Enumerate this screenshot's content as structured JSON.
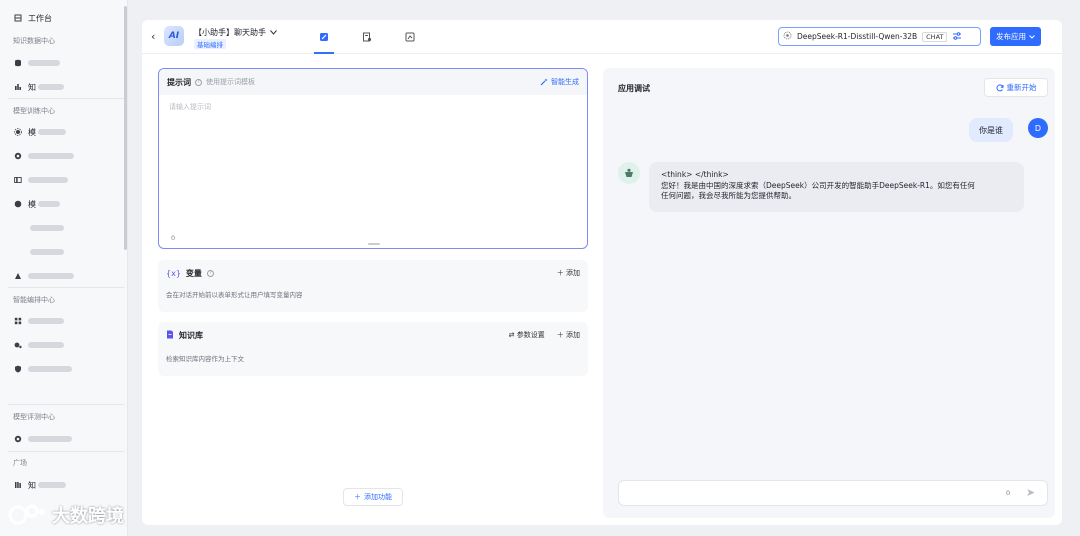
{
  "sidebar": {
    "top_item": "工作台",
    "section_knowledge": "知识数据中心",
    "knowledge_item_2_prefix": "知",
    "section_model_train": "模型训练中心",
    "model_item_1_prefix": "模",
    "model_item_4_prefix": "模",
    "section_orchestration": "智能编排中心",
    "section_model_eval": "模型评测中心",
    "section_plaza": "广场",
    "plaza_item_1_prefix": "知"
  },
  "header": {
    "app_name": "【小助手】聊天助手",
    "app_tag": "基础编排",
    "logo_text": "AI",
    "model_name": "DeepSeek-R1-Disstill-Qwen-32B",
    "model_badge": "CHAT",
    "publish_label": "发布应用"
  },
  "prompt": {
    "title": "提示词",
    "template_hint": "使用提示词模板",
    "ai_generate_label": "智能生成",
    "placeholder": "请输入提示词",
    "char_count": "0"
  },
  "variables": {
    "title": "变量",
    "add_label": "添加",
    "description": "会在对话开始前以表单形式让用户填写变量内容"
  },
  "knowledge": {
    "title": "知识库",
    "params_label": "参数设置",
    "add_label": "添加",
    "description": "检索知识库内容作为上下文"
  },
  "add_function_label": "添加功能",
  "debug": {
    "title": "应用调试",
    "restart_label": "重新开始",
    "user_avatar_letter": "D",
    "user_message": "你是谁",
    "bot_think": "<think> </think>",
    "bot_message_line1": "您好！我是由中国的深度求索（DeepSeek）公司开发的智能助手DeepSeek-R1。如您有任何",
    "bot_message_line2": "任何问题，我会尽我所能为您提供帮助。",
    "input_count": "0"
  },
  "watermark_text": "大数跨境",
  "colors": {
    "accent": "#2f6bff",
    "border_active": "#7d8cf0",
    "bubble_user": "#e1eaff"
  },
  "icons": [
    "home-icon",
    "database-icon",
    "chart-icon",
    "model-icon",
    "layers-icon",
    "node-icon",
    "dataset-icon",
    "grid-icon",
    "flow-icon",
    "shield-icon",
    "eval-icon",
    "book-icon",
    "chevron-left-icon",
    "chevron-down-icon",
    "wand-icon",
    "refresh-icon",
    "send-icon",
    "plus-icon"
  ]
}
